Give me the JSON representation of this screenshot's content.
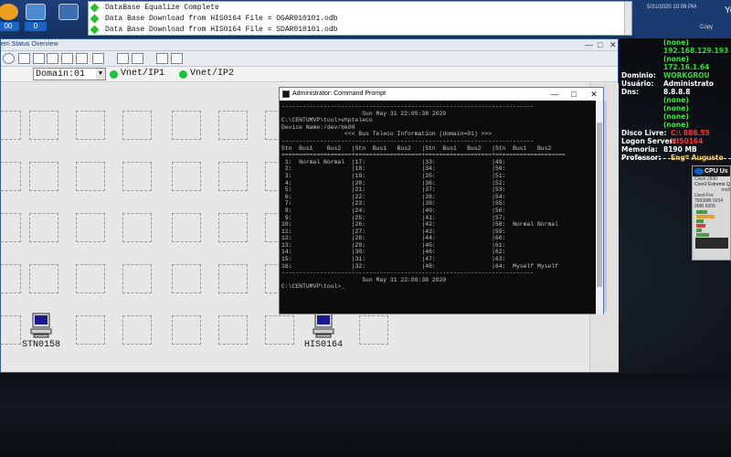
{
  "top_bar": {
    "counters": [
      "00",
      "0"
    ],
    "messages": [
      "DataBase Equalize Complete",
      "Data Base Download from HIS0164 File = OGAR010101.odb",
      "Data Base Download from HIS0164 File = SDAR010101.odb"
    ],
    "datetime": "5/31/2020 10:09 PM",
    "copy_label": "Copy",
    "edge_label": "Yo"
  },
  "main_window": {
    "title": "em Status Overview",
    "domain_value": "Domain:01",
    "vnet1": "Vnet/IP1",
    "vnet2": "Vnet/IP2",
    "stations": [
      "STN0158",
      "HIS0164"
    ]
  },
  "info_panel": {
    "rows": [
      {
        "key": "",
        "value": "(none)",
        "color": "#2ff02f"
      },
      {
        "key": "",
        "value": "192.168.129.193",
        "color": "#28e028"
      },
      {
        "key": "",
        "value": "(none)",
        "color": "#2ff02f"
      },
      {
        "key": "",
        "value": "172.16.1.64",
        "color": "#28e028"
      },
      {
        "key": "Dominio:",
        "value": "WORKGROU",
        "color": "#28e028"
      },
      {
        "key": "Usuário:",
        "value": "Administrato",
        "color": "#ffffff"
      },
      {
        "key": "Dns:",
        "value": "8.8.8.8",
        "color": "#ffffff"
      },
      {
        "key": "",
        "value": "(none)",
        "color": "#2ff02f"
      },
      {
        "key": "",
        "value": "(none)",
        "color": "#2ff02f"
      },
      {
        "key": "",
        "value": "(none)",
        "color": "#2ff02f"
      },
      {
        "key": "",
        "value": "(none)",
        "color": "#2ff02f"
      },
      {
        "key": "Disco Livre:",
        "value": "C:\\ 888.55",
        "color": "#ff3333"
      },
      {
        "key": "Logon Server:",
        "value": "HIS0164",
        "color": "#ff3333"
      },
      {
        "key": "Memoria:",
        "value": "8190 MB",
        "color": "#ffffff"
      },
      {
        "key": "Professor:",
        "value": "Engº Augusto",
        "color": "#ffd24a"
      }
    ]
  },
  "cpu_widget": {
    "title": "CPU Us",
    "lines": [
      "Clock 2930",
      "Core2 Extreme Q6",
      "mult",
      "Used   Fre",
      "7893MB  0204",
      "0MB  6009"
    ]
  },
  "cmd": {
    "title": "Administrator: Command Prompt",
    "lines": [
      "------------------------------------------------------------------------",
      "                       Sun May 31 22:05:38 2020",
      "",
      "C:\\CENTUMVP\\tool>vhpteleco",
      "Device Name:/dev/bk00",
      "",
      "                  <<< Bus Teleco Information (domain=01) >>>",
      "------------------------------------------------------------------------",
      "Stn  Bus1    Bus2   |Stn  Bus1   Bus2   |Stn  Bus1   Bus2   |Stn  Bus1   Bus2",
      "====================+===================+===================+====================",
      " 1:  Normal Normal  |17:                |33:                |49:",
      " 2:                 |18:                |34:                |50:",
      " 3:                 |19:                |35:                |51:",
      " 4:                 |20:                |36:                |52:",
      " 5:                 |21:                |37:                |53:",
      " 6:                 |22:                |38:                |54:",
      " 7:                 |23:                |39:                |55:",
      " 8:                 |24:                |40:                |56:",
      " 9:                 |25:                |41:                |57:",
      "10:                 |26:                |42:                |58:  Normal Normal",
      "11:                 |27:                |43:                |59:",
      "12:                 |28:                |44:                |60:",
      "13:                 |29:                |45:                |61:",
      "14:                 |30:                |46:                |62:",
      "15:                 |31:                |47:                |63:",
      "16:                 |32:                |48:                |64:  Myself Myself",
      "------------------------------------------------------------------------",
      "                       Sun May 31 22:09:38 2020",
      "",
      "C:\\CENTUMVP\\tool>_"
    ]
  }
}
